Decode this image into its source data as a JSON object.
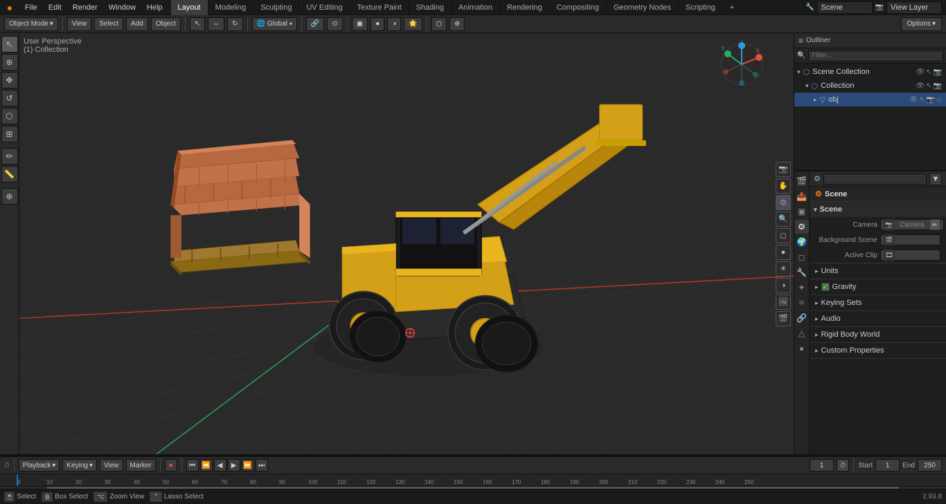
{
  "app": {
    "version": "2.93.8"
  },
  "menubar": {
    "logo": "●",
    "items": [
      "File",
      "Edit",
      "Render",
      "Window",
      "Help"
    ],
    "workspace_tabs": [
      "Layout",
      "Modeling",
      "Sculpting",
      "UV Editing",
      "Texture Paint",
      "Shading",
      "Animation",
      "Rendering",
      "Compositing",
      "Geometry Nodes",
      "Scripting"
    ],
    "active_tab": "Layout",
    "plus_icon": "+",
    "scene_label": "Scene",
    "view_layer_label": "View Layer"
  },
  "viewport_header": {
    "mode": "Object Mode",
    "view": "View",
    "select": "Select",
    "add": "Add",
    "object": "Object",
    "transform_global": "Global",
    "options_label": "Options"
  },
  "viewport": {
    "perspective_label": "User Perspective",
    "collection_label": "(1) Collection",
    "origin_marker": "⊙"
  },
  "left_tools": {
    "items": [
      "↖",
      "✥",
      "↺",
      "⬡",
      "✏",
      "✂",
      "⬜",
      "◎",
      "⊕"
    ]
  },
  "viewport_right_tools": {
    "items": [
      "👁",
      "⬜",
      "●",
      "●",
      "◑",
      "◐",
      "☀",
      "◻",
      "📷",
      "🖼"
    ]
  },
  "outliner": {
    "title": "Outliner",
    "search_placeholder": "Filter...",
    "items": [
      {
        "name": "Scene Collection",
        "level": 0,
        "type": "scene",
        "expanded": true
      },
      {
        "name": "Collection",
        "level": 1,
        "type": "collection",
        "expanded": true
      },
      {
        "name": "obj",
        "level": 2,
        "type": "mesh"
      }
    ]
  },
  "properties": {
    "header_icon": "⚙",
    "scene_label": "Scene",
    "edit_icon": "✏",
    "sections": [
      {
        "id": "scene",
        "label": "Scene",
        "expanded": true,
        "rows": [
          {
            "label": "Camera",
            "type": "input_icon",
            "value": ""
          },
          {
            "label": "Background Scene",
            "type": "input_icon",
            "value": ""
          },
          {
            "label": "Active Clip",
            "type": "input_icon",
            "value": ""
          }
        ]
      },
      {
        "id": "units",
        "label": "Units",
        "expanded": false,
        "rows": []
      },
      {
        "id": "gravity",
        "label": "Gravity",
        "expanded": false,
        "has_checkbox": true,
        "rows": []
      },
      {
        "id": "keying_sets",
        "label": "Keying Sets",
        "expanded": false,
        "rows": []
      },
      {
        "id": "audio",
        "label": "Audio",
        "expanded": false,
        "rows": []
      },
      {
        "id": "rigid_body_world",
        "label": "Rigid Body World",
        "expanded": false,
        "rows": []
      },
      {
        "id": "custom_properties",
        "label": "Custom Properties",
        "expanded": false,
        "rows": []
      }
    ],
    "tabs": [
      "render",
      "output",
      "view_layer",
      "scene",
      "world",
      "object",
      "modifiers",
      "particles",
      "physics",
      "constraints",
      "data",
      "material"
    ]
  },
  "timeline": {
    "playback_label": "Playback",
    "keying_label": "Keying",
    "view_label": "View",
    "marker_label": "Marker",
    "frame_current": "1",
    "start_label": "Start",
    "start_value": "1",
    "end_label": "End",
    "end_value": "250",
    "transport_icons": [
      "⏹",
      "⏮",
      "⏪",
      "◀",
      "▶",
      "⏩",
      "⏭"
    ]
  },
  "timeline_ruler": {
    "marks": [
      "0",
      "10",
      "20",
      "30",
      "40",
      "50",
      "60",
      "70",
      "80",
      "90",
      "100",
      "110",
      "120",
      "130",
      "140",
      "150",
      "160",
      "170",
      "180",
      "190",
      "200",
      "210",
      "220",
      "230",
      "240",
      "250"
    ]
  },
  "status_bar": {
    "select_key": "Select",
    "box_select_key": "Box Select",
    "zoom_view_key": "Zoom View",
    "lasso_select_key": "Lasso Select"
  }
}
